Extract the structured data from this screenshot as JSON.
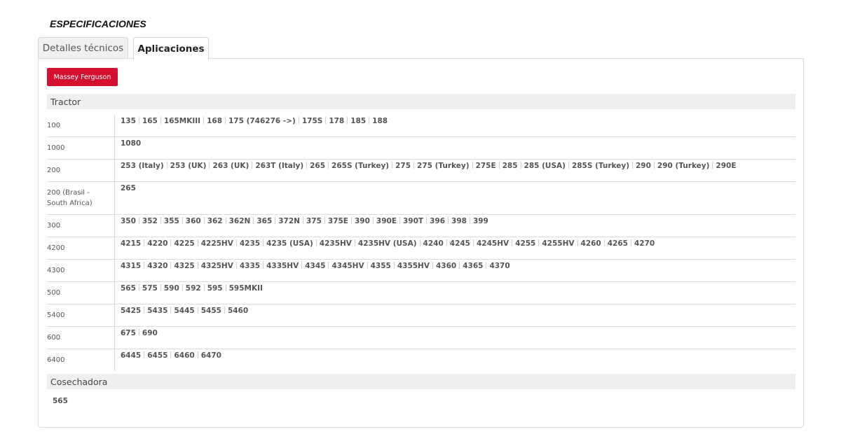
{
  "section_title": "ESPECIFICACIONES",
  "tabs": [
    {
      "label": "Detalles técnicos",
      "active": false
    },
    {
      "label": "Aplicaciones",
      "active": true
    }
  ],
  "brand_button": "Massey Ferguson",
  "colors": {
    "brand": "#d5102f",
    "group_header_bg": "#efefef"
  },
  "groups": [
    {
      "title": "Tractor",
      "rows": [
        {
          "label": "100",
          "models": [
            "135",
            "165",
            "165MKIII",
            "168",
            "175 (746276 ->)",
            "175S",
            "178",
            "185",
            "188"
          ]
        },
        {
          "label": "1000",
          "models": [
            "1080"
          ]
        },
        {
          "label": "200",
          "models": [
            "253 (Italy)",
            "253 (UK)",
            "263 (UK)",
            "263T (Italy)",
            "265",
            "265S (Turkey)",
            "275",
            "275 (Turkey)",
            "275E",
            "285",
            "285 (USA)",
            "285S (Turkey)",
            "290",
            "290 (Turkey)",
            "290E"
          ]
        },
        {
          "label": "200 (Brasil - South Africa)",
          "models": [
            "265"
          ]
        },
        {
          "label": "300",
          "models": [
            "350",
            "352",
            "355",
            "360",
            "362",
            "362N",
            "365",
            "372N",
            "375",
            "375E",
            "390",
            "390E",
            "390T",
            "396",
            "398",
            "399"
          ]
        },
        {
          "label": "4200",
          "models": [
            "4215",
            "4220",
            "4225",
            "4225HV",
            "4235",
            "4235 (USA)",
            "4235HV",
            "4235HV (USA)",
            "4240",
            "4245",
            "4245HV",
            "4255",
            "4255HV",
            "4260",
            "4265",
            "4270"
          ]
        },
        {
          "label": "4300",
          "models": [
            "4315",
            "4320",
            "4325",
            "4325HV",
            "4335",
            "4335HV",
            "4345",
            "4345HV",
            "4355",
            "4355HV",
            "4360",
            "4365",
            "4370"
          ]
        },
        {
          "label": "500",
          "models": [
            "565",
            "575",
            "590",
            "592",
            "595",
            "595MKII"
          ]
        },
        {
          "label": "5400",
          "models": [
            "5425",
            "5435",
            "5445",
            "5455",
            "5460"
          ]
        },
        {
          "label": "600",
          "models": [
            "675",
            "690"
          ]
        },
        {
          "label": "6400",
          "models": [
            "6445",
            "6455",
            "6460",
            "6470"
          ]
        }
      ]
    },
    {
      "title": "Cosechadora",
      "models": [
        "565"
      ]
    }
  ]
}
